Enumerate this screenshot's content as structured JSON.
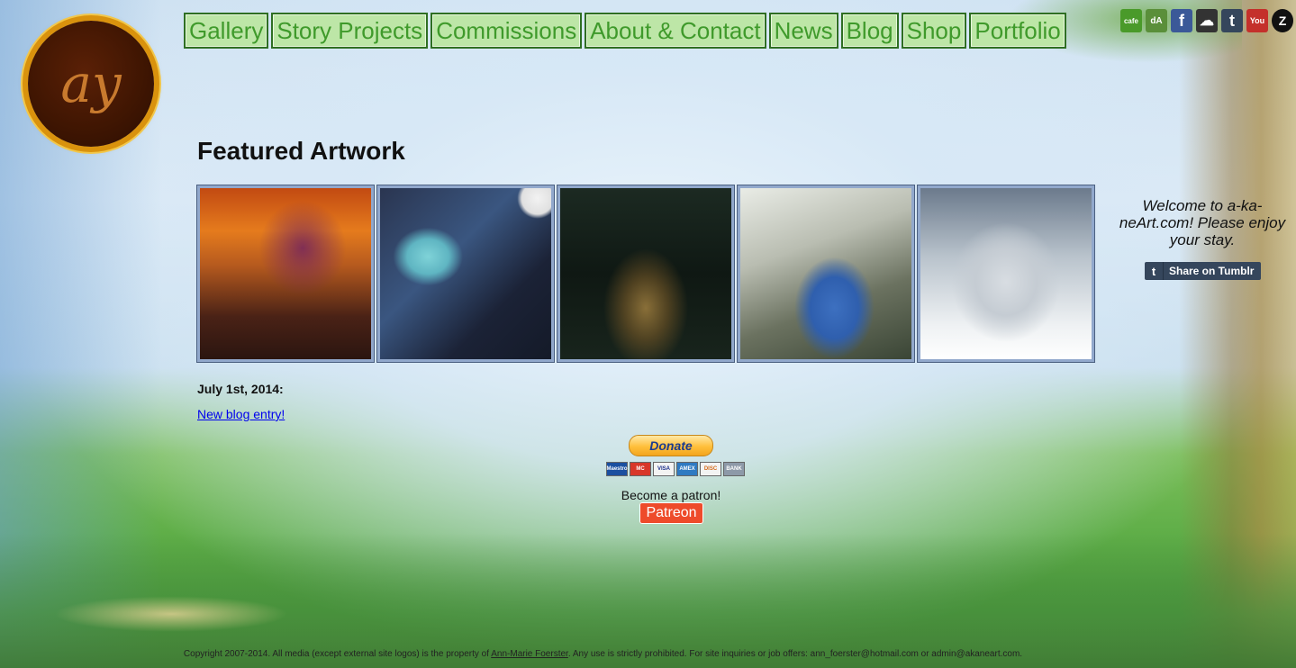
{
  "logo": {
    "mark": "ay"
  },
  "nav": {
    "items": [
      {
        "label": "Gallery"
      },
      {
        "label": "Story Projects"
      },
      {
        "label": "Commissions"
      },
      {
        "label": "About & Contact"
      },
      {
        "label": "News"
      },
      {
        "label": "Blog"
      },
      {
        "label": "Shop"
      },
      {
        "label": "Portfolio"
      }
    ]
  },
  "social": {
    "icons": [
      {
        "name": "cafepress-icon",
        "glyph": "cafe",
        "color": "#4a9a2a"
      },
      {
        "name": "deviantart-icon",
        "glyph": "dA",
        "color": "#5a8f3a"
      },
      {
        "name": "facebook-icon",
        "glyph": "f",
        "color": "#3b5998"
      },
      {
        "name": "soundcloud-icon",
        "glyph": "☁",
        "color": "#333333"
      },
      {
        "name": "tumblr-icon",
        "glyph": "t",
        "color": "#35465c"
      },
      {
        "name": "youtube-icon",
        "glyph": "You",
        "color": "#c4302b"
      },
      {
        "name": "z-icon",
        "glyph": "Z",
        "color": "#111111"
      }
    ]
  },
  "main": {
    "featured_title": "Featured Artwork",
    "news": {
      "date": "July 1st, 2014:",
      "link": "New blog entry!"
    }
  },
  "sidebar": {
    "welcome": "Welcome to a-ka-neArt.com! Please enjoy your stay.",
    "tumblr_share": "Share on Tumblr",
    "tumblr_glyph": "t"
  },
  "support": {
    "donate_label": "Donate",
    "cards": [
      "Maestro",
      "MC",
      "VISA",
      "AMEX",
      "DISC",
      "BANK"
    ],
    "patron_text": "Become a patron!",
    "patreon_label": "Patreon"
  },
  "footer": {
    "copyright_pre": "Copyright 2007-2014. All media (except external site logos) is the property of ",
    "owner": "Ann-Marie Foerster",
    "copyright_post": ". Any use is strictly prohibited. For site inquiries or job offers: ann_foerster@hotmail.com or admin@akaneart.com."
  }
}
